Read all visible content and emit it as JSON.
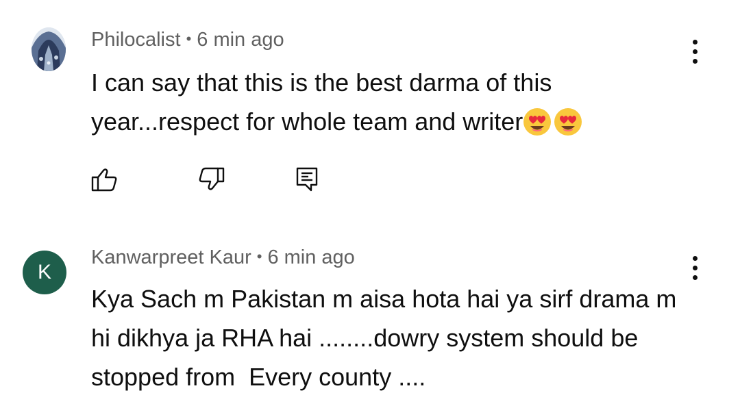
{
  "comments": [
    {
      "author": "Philocalist",
      "separator": "•",
      "time": "6 min ago",
      "text": "I can say that this is the best darma of this year...respect for whole team and writer",
      "emojis": [
        "smiling-face-with-heart-eyes",
        "smiling-face-with-heart-eyes"
      ],
      "avatar": "photo",
      "actions": [
        "like-icon",
        "dislike-icon",
        "reply-icon"
      ],
      "menu_icon": "more-vertical-icon"
    },
    {
      "author": "Kanwarpreet Kaur",
      "separator": "•",
      "time": "6 min ago",
      "text": "Kya Sach m Pakistan m aisa hota hai ya sirf drama m hi dikhya ja RHA hai ........dowry system should be stopped from  Every county ....",
      "avatar_letter": "K",
      "avatar_color": "#1e5e4b",
      "menu_icon": "more-vertical-icon"
    }
  ],
  "colors": {
    "meta_text": "#606060",
    "body_text": "#0f0f0f",
    "background": "#ffffff"
  }
}
